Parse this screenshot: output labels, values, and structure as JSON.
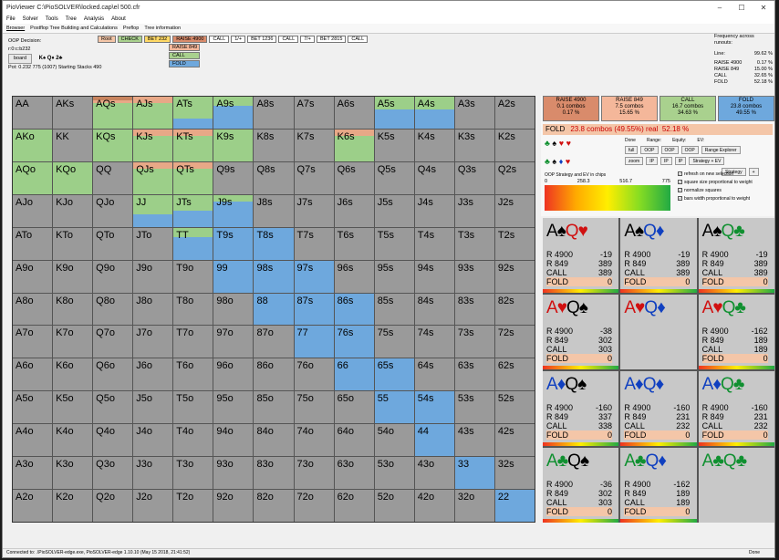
{
  "window": {
    "title": "PioViewer C:\\PioSOLVER\\locked.cap\\el 500.cfr"
  },
  "menu": [
    "File",
    "Solver",
    "Tools",
    "Tree",
    "Analysis",
    "About"
  ],
  "tabs": [
    "Browser",
    "Postflop Tree Building and Calculations",
    "Preflop",
    "Tree information"
  ],
  "decision": {
    "label": "OOP Decision:",
    "line": "r:0:c:b232",
    "board_btn": "board",
    "board_cards": "K♠ Q♦ 2♣",
    "pot": "Pot: 0.232 775 (1007) Starting Stacks 490"
  },
  "tree": {
    "row": [
      "Root",
      "CHECK",
      "BET 232",
      "RAISE 4900",
      "CALL",
      "1/+",
      "BET 1236",
      "CALL",
      "7/+",
      "BET 2815",
      "CALL"
    ],
    "sub": [
      "RAISE 849",
      "CALL",
      "FOLD"
    ]
  },
  "frequency": {
    "title": "Frequency across runouts:",
    "rows": [
      {
        "k": "Line:",
        "v": "99.62 %"
      },
      {
        "k": "RAISE 4900",
        "v": "0.17 %"
      },
      {
        "k": "RAISE 849",
        "v": "15.00 %"
      },
      {
        "k": "CALL",
        "v": "32.65 %"
      },
      {
        "k": "FOLD",
        "v": "52.18 %"
      }
    ]
  },
  "grid": [
    [
      "AA",
      "AKs",
      "AQs",
      "AJs",
      "ATs",
      "A9s",
      "A8s",
      "A7s",
      "A6s",
      "A5s",
      "A4s",
      "A3s",
      "A2s"
    ],
    [
      "AKo",
      "KK",
      "KQs",
      "KJs",
      "KTs",
      "K9s",
      "K8s",
      "K7s",
      "K6s",
      "K5s",
      "K4s",
      "K3s",
      "K2s"
    ],
    [
      "AQo",
      "KQo",
      "QQ",
      "QJs",
      "QTs",
      "Q9s",
      "Q8s",
      "Q7s",
      "Q6s",
      "Q5s",
      "Q4s",
      "Q3s",
      "Q2s"
    ],
    [
      "AJo",
      "KJo",
      "QJo",
      "JJ",
      "JTs",
      "J9s",
      "J8s",
      "J7s",
      "J6s",
      "J5s",
      "J4s",
      "J3s",
      "J2s"
    ],
    [
      "ATo",
      "KTo",
      "QTo",
      "JTo",
      "TT",
      "T9s",
      "T8s",
      "T7s",
      "T6s",
      "T5s",
      "T4s",
      "T3s",
      "T2s"
    ],
    [
      "A9o",
      "K9o",
      "Q9o",
      "J9o",
      "T9o",
      "99",
      "98s",
      "97s",
      "96s",
      "95s",
      "94s",
      "93s",
      "92s"
    ],
    [
      "A8o",
      "K8o",
      "Q8o",
      "J8o",
      "T8o",
      "98o",
      "88",
      "87s",
      "86s",
      "85s",
      "84s",
      "83s",
      "82s"
    ],
    [
      "A7o",
      "K7o",
      "Q7o",
      "J7o",
      "T7o",
      "97o",
      "87o",
      "77",
      "76s",
      "75s",
      "74s",
      "73s",
      "72s"
    ],
    [
      "A6o",
      "K6o",
      "Q6o",
      "J6o",
      "T6o",
      "96o",
      "86o",
      "76o",
      "66",
      "65s",
      "64s",
      "63s",
      "62s"
    ],
    [
      "A5o",
      "K5o",
      "Q5o",
      "J5o",
      "T5o",
      "95o",
      "85o",
      "75o",
      "65o",
      "55",
      "54s",
      "53s",
      "52s"
    ],
    [
      "A4o",
      "K4o",
      "Q4o",
      "J4o",
      "T4o",
      "94o",
      "84o",
      "74o",
      "64o",
      "54o",
      "44",
      "43s",
      "42s"
    ],
    [
      "A3o",
      "K3o",
      "Q3o",
      "J3o",
      "T3o",
      "93o",
      "83o",
      "73o",
      "63o",
      "53o",
      "43o",
      "33",
      "32s"
    ],
    [
      "A2o",
      "K2o",
      "Q2o",
      "J2o",
      "T2o",
      "92o",
      "82o",
      "72o",
      "62o",
      "52o",
      "42o",
      "32o",
      "22"
    ]
  ],
  "cell_strategy": {
    "AQs": {
      "raise": 0.1,
      "raise2": 0.1,
      "call": 0.8,
      "fold": 0.0
    },
    "AJs": {
      "raise": 0.0,
      "raise2": 0.2,
      "call": 0.8,
      "fold": 0.0
    },
    "ATs": {
      "raise": 0.0,
      "raise2": 0.0,
      "call": 0.7,
      "fold": 0.3
    },
    "A9s": {
      "raise": 0.0,
      "raise2": 0.0,
      "call": 0.3,
      "fold": 0.7
    },
    "A5s": {
      "raise": 0.0,
      "raise2": 0.0,
      "call": 0.4,
      "fold": 0.6
    },
    "A4s": {
      "raise": 0.0,
      "raise2": 0.0,
      "call": 0.4,
      "fold": 0.6
    },
    "AKo": {
      "raise": 0.0,
      "raise2": 0.0,
      "call": 1.0,
      "fold": 0.0
    },
    "KQs": {
      "raise": 0.0,
      "raise2": 0.0,
      "call": 1.0,
      "fold": 0.0
    },
    "KJs": {
      "raise": 0.0,
      "raise2": 0.2,
      "call": 0.8,
      "fold": 0.0
    },
    "KTs": {
      "raise": 0.0,
      "raise2": 0.2,
      "call": 0.8,
      "fold": 0.0
    },
    "K9s": {
      "raise": 0.0,
      "raise2": 0.0,
      "call": 1.0,
      "fold": 0.0
    },
    "K6s": {
      "raise": 0.0,
      "raise2": 0.2,
      "call": 0.8,
      "fold": 0.0
    },
    "AQo": {
      "raise": 0.0,
      "raise2": 0.0,
      "call": 1.0,
      "fold": 0.0
    },
    "KQo": {
      "raise": 0.0,
      "raise2": 0.0,
      "call": 1.0,
      "fold": 0.0
    },
    "QJs": {
      "raise": 0.0,
      "raise2": 0.2,
      "call": 0.8,
      "fold": 0.0
    },
    "QTs": {
      "raise": 0.0,
      "raise2": 0.2,
      "call": 0.8,
      "fold": 0.0
    },
    "JJ": {
      "raise": 0.0,
      "raise2": 0.0,
      "call": 0.6,
      "fold": 0.4
    },
    "JTs": {
      "raise": 0.0,
      "raise2": 0.0,
      "call": 0.5,
      "fold": 0.5
    },
    "J9s": {
      "raise": 0.0,
      "raise2": 0.0,
      "call": 0.2,
      "fold": 0.8
    },
    "TT": {
      "raise": 0.0,
      "raise2": 0.0,
      "call": 0.3,
      "fold": 0.7
    },
    "T9s": {
      "raise": 0.0,
      "raise2": 0.0,
      "call": 0.0,
      "fold": 1.0
    },
    "T8s": {
      "raise": 0.0,
      "raise2": 0.0,
      "call": 0.0,
      "fold": 1.0
    },
    "99": {
      "raise": 0.0,
      "raise2": 0.0,
      "call": 0.0,
      "fold": 1.0
    },
    "98s": {
      "raise": 0.0,
      "raise2": 0.0,
      "call": 0.0,
      "fold": 1.0
    },
    "97s": {
      "raise": 0.0,
      "raise2": 0.0,
      "call": 0.0,
      "fold": 1.0
    },
    "88": {
      "raise": 0.0,
      "raise2": 0.0,
      "call": 0.0,
      "fold": 1.0
    },
    "87s": {
      "raise": 0.0,
      "raise2": 0.0,
      "call": 0.0,
      "fold": 1.0
    },
    "86s": {
      "raise": 0.0,
      "raise2": 0.0,
      "call": 0.0,
      "fold": 1.0
    },
    "77": {
      "raise": 0.0,
      "raise2": 0.0,
      "call": 0.0,
      "fold": 1.0
    },
    "76s": {
      "raise": 0.0,
      "raise2": 0.0,
      "call": 0.0,
      "fold": 1.0
    },
    "66": {
      "raise": 0.0,
      "raise2": 0.0,
      "call": 0.0,
      "fold": 1.0
    },
    "65s": {
      "raise": 0.0,
      "raise2": 0.0,
      "call": 0.0,
      "fold": 1.0
    },
    "55": {
      "raise": 0.0,
      "raise2": 0.0,
      "call": 0.0,
      "fold": 1.0
    },
    "54s": {
      "raise": 0.0,
      "raise2": 0.0,
      "call": 0.0,
      "fold": 1.0
    },
    "44": {
      "raise": 0.0,
      "raise2": 0.0,
      "call": 0.0,
      "fold": 1.0
    },
    "33": {
      "raise": 0.0,
      "raise2": 0.0,
      "call": 0.0,
      "fold": 1.0
    },
    "22": {
      "raise": 0.0,
      "raise2": 0.0,
      "call": 0.0,
      "fold": 1.0
    }
  },
  "actions": [
    {
      "name": "RAISE 4900",
      "combos": "0.1 combos",
      "pct": "0.17 %",
      "color": "#d98b6b"
    },
    {
      "name": "RAISE 849",
      "combos": "7.5 combos",
      "pct": "15.65 %",
      "color": "#f4b79a"
    },
    {
      "name": "CALL",
      "combos": "16.7 combos",
      "pct": "34.63 %",
      "color": "#a9d18e"
    },
    {
      "name": "FOLD",
      "combos": "23.8 combos",
      "pct": "49.55 %",
      "color": "#6ea8dd"
    }
  ],
  "fold_summary": {
    "label": "FOLD",
    "combos": "23.8 combos (49.55%) real",
    "real": "52.18 %"
  },
  "controls": {
    "headers": [
      "Done",
      "Range:",
      "Equity:",
      "EV:"
    ],
    "rows": [
      [
        "full",
        "OOP",
        "OOP",
        "OOP"
      ],
      [
        "zoom",
        "IP",
        "IP",
        "IP"
      ]
    ],
    "range_explorer": "Range Explorer",
    "strategy_ev": "Strategy + EV",
    "strategy": "Strategy"
  },
  "ev_label": "OOP Strategy and EV in chips",
  "gradient": [
    "0",
    "258.3",
    "516.7",
    "775"
  ],
  "checkboxes": [
    {
      "label": "refresh on new selection",
      "checked": true
    },
    {
      "label": "square size proportional to weight",
      "checked": true
    },
    {
      "label": "normalize squares",
      "checked": true
    },
    {
      "label": "bars width proportional to weight",
      "checked": true
    }
  ],
  "combos": [
    {
      "c1": "A",
      "s1": "♠",
      "k1": "black",
      "c2": "Q",
      "s2": "♥",
      "k2": "red",
      "r1": "-19",
      "r2": "389",
      "call": "389",
      "fold": "0"
    },
    {
      "c1": "A",
      "s1": "♠",
      "k1": "black",
      "c2": "Q",
      "s2": "♦",
      "k2": "blue",
      "r1": "-19",
      "r2": "389",
      "call": "389",
      "fold": "0"
    },
    {
      "c1": "A",
      "s1": "♠",
      "k1": "black",
      "c2": "Q",
      "s2": "♣",
      "k2": "green",
      "r1": "-19",
      "r2": "389",
      "call": "389",
      "fold": "0"
    },
    {
      "c1": "A",
      "s1": "♥",
      "k1": "red",
      "c2": "Q",
      "s2": "♠",
      "k2": "black",
      "r1": "-38",
      "r2": "302",
      "call": "303",
      "fold": "0"
    },
    {
      "c1": "A",
      "s1": "♥",
      "k1": "red",
      "c2": "Q",
      "s2": "♦",
      "k2": "blue",
      "r1": "",
      "r2": "",
      "call": "",
      "fold": ""
    },
    {
      "c1": "A",
      "s1": "♥",
      "k1": "red",
      "c2": "Q",
      "s2": "♣",
      "k2": "green",
      "r1": "-162",
      "r2": "189",
      "call": "189",
      "fold": "0"
    },
    {
      "c1": "A",
      "s1": "♦",
      "k1": "blue",
      "c2": "Q",
      "s2": "♠",
      "k2": "black",
      "r1": "-160",
      "r2": "337",
      "call": "338",
      "fold": "0"
    },
    {
      "c1": "A",
      "s1": "♦",
      "k1": "blue",
      "c2": "Q",
      "s2": "♦",
      "k2": "blue",
      "r1": "-160",
      "r2": "231",
      "call": "232",
      "fold": "0"
    },
    {
      "c1": "A",
      "s1": "♦",
      "k1": "blue",
      "c2": "Q",
      "s2": "♣",
      "k2": "green",
      "r1": "-160",
      "r2": "231",
      "call": "232",
      "fold": "0"
    },
    {
      "c1": "A",
      "s1": "♣",
      "k1": "green",
      "c2": "Q",
      "s2": "♠",
      "k2": "black",
      "r1": "-36",
      "r2": "302",
      "call": "303",
      "fold": "0"
    },
    {
      "c1": "A",
      "s1": "♣",
      "k1": "green",
      "c2": "Q",
      "s2": "♦",
      "k2": "blue",
      "r1": "-162",
      "r2": "189",
      "call": "189",
      "fold": "0"
    },
    {
      "c1": "A",
      "s1": "♣",
      "k1": "green",
      "c2": "Q",
      "s2": "♣",
      "k2": "green",
      "r1": "",
      "r2": "",
      "call": "",
      "fold": ""
    }
  ],
  "statusbar": {
    "left": "Connected to: .\\PioSOLVER-edge.exe, PioSOLVER-edge 1.10.10 (May 15 2018, 21:41:52)",
    "right": "Done"
  }
}
